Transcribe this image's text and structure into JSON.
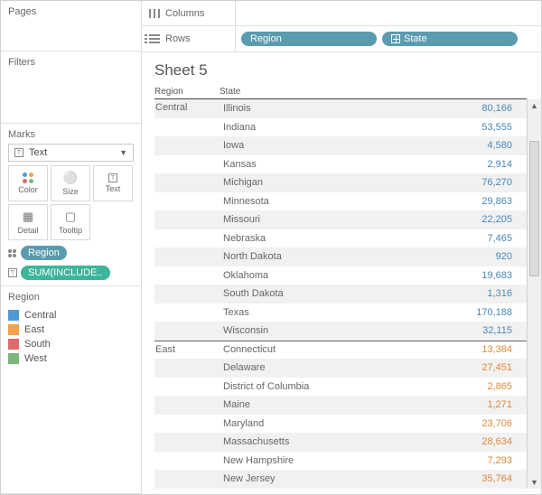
{
  "panels": {
    "pages": "Pages",
    "filters": "Filters",
    "marks": "Marks",
    "region_legend_title": "Region"
  },
  "marks": {
    "type": "Text",
    "buttons": {
      "color": "Color",
      "size": "Size",
      "text": "Text",
      "detail": "Detail",
      "tooltip": "Tooltip"
    },
    "pills": {
      "region": "Region",
      "sum_include": "SUM(INCLUDE.."
    }
  },
  "legend": [
    {
      "key": "central",
      "label": "Central"
    },
    {
      "key": "east",
      "label": "East"
    },
    {
      "key": "south",
      "label": "South"
    },
    {
      "key": "west",
      "label": "West"
    }
  ],
  "shelves": {
    "columns_label": "Columns",
    "rows_label": "Rows",
    "rows": [
      {
        "label": "Region",
        "expand": false
      },
      {
        "label": "State",
        "expand": true
      }
    ]
  },
  "sheet": {
    "title": "Sheet 5",
    "headers": {
      "region": "Region",
      "state": "State"
    },
    "rows": [
      {
        "region": "Central",
        "state": "Illinois",
        "value": "80,166",
        "vclass": "val-central",
        "show_region": true,
        "sep": false
      },
      {
        "region": "Central",
        "state": "Indiana",
        "value": "53,555",
        "vclass": "val-central",
        "show_region": false,
        "sep": false
      },
      {
        "region": "Central",
        "state": "Iowa",
        "value": "4,580",
        "vclass": "val-central",
        "show_region": false,
        "sep": false
      },
      {
        "region": "Central",
        "state": "Kansas",
        "value": "2,914",
        "vclass": "val-central",
        "show_region": false,
        "sep": false
      },
      {
        "region": "Central",
        "state": "Michigan",
        "value": "76,270",
        "vclass": "val-central",
        "show_region": false,
        "sep": false
      },
      {
        "region": "Central",
        "state": "Minnesota",
        "value": "29,863",
        "vclass": "val-central",
        "show_region": false,
        "sep": false
      },
      {
        "region": "Central",
        "state": "Missouri",
        "value": "22,205",
        "vclass": "val-central",
        "show_region": false,
        "sep": false
      },
      {
        "region": "Central",
        "state": "Nebraska",
        "value": "7,465",
        "vclass": "val-central",
        "show_region": false,
        "sep": false
      },
      {
        "region": "Central",
        "state": "North Dakota",
        "value": "920",
        "vclass": "val-central",
        "show_region": false,
        "sep": false
      },
      {
        "region": "Central",
        "state": "Oklahoma",
        "value": "19,683",
        "vclass": "val-central",
        "show_region": false,
        "sep": false
      },
      {
        "region": "Central",
        "state": "South Dakota",
        "value": "1,316",
        "vclass": "val-central",
        "show_region": false,
        "sep": false
      },
      {
        "region": "Central",
        "state": "Texas",
        "value": "170,188",
        "vclass": "val-central",
        "show_region": false,
        "sep": false
      },
      {
        "region": "Central",
        "state": "Wisconsin",
        "value": "32,115",
        "vclass": "val-central",
        "show_region": false,
        "sep": false
      },
      {
        "region": "East",
        "state": "Connecticut",
        "value": "13,384",
        "vclass": "val-east",
        "show_region": true,
        "sep": true
      },
      {
        "region": "East",
        "state": "Delaware",
        "value": "27,451",
        "vclass": "val-east",
        "show_region": false,
        "sep": false
      },
      {
        "region": "East",
        "state": "District of Columbia",
        "value": "2,865",
        "vclass": "val-east",
        "show_region": false,
        "sep": false
      },
      {
        "region": "East",
        "state": "Maine",
        "value": "1,271",
        "vclass": "val-east",
        "show_region": false,
        "sep": false
      },
      {
        "region": "East",
        "state": "Maryland",
        "value": "23,706",
        "vclass": "val-east",
        "show_region": false,
        "sep": false
      },
      {
        "region": "East",
        "state": "Massachusetts",
        "value": "28,634",
        "vclass": "val-east",
        "show_region": false,
        "sep": false
      },
      {
        "region": "East",
        "state": "New Hampshire",
        "value": "7,293",
        "vclass": "val-east",
        "show_region": false,
        "sep": false
      },
      {
        "region": "East",
        "state": "New Jersey",
        "value": "35,764",
        "vclass": "val-east",
        "show_region": false,
        "sep": false
      }
    ]
  }
}
